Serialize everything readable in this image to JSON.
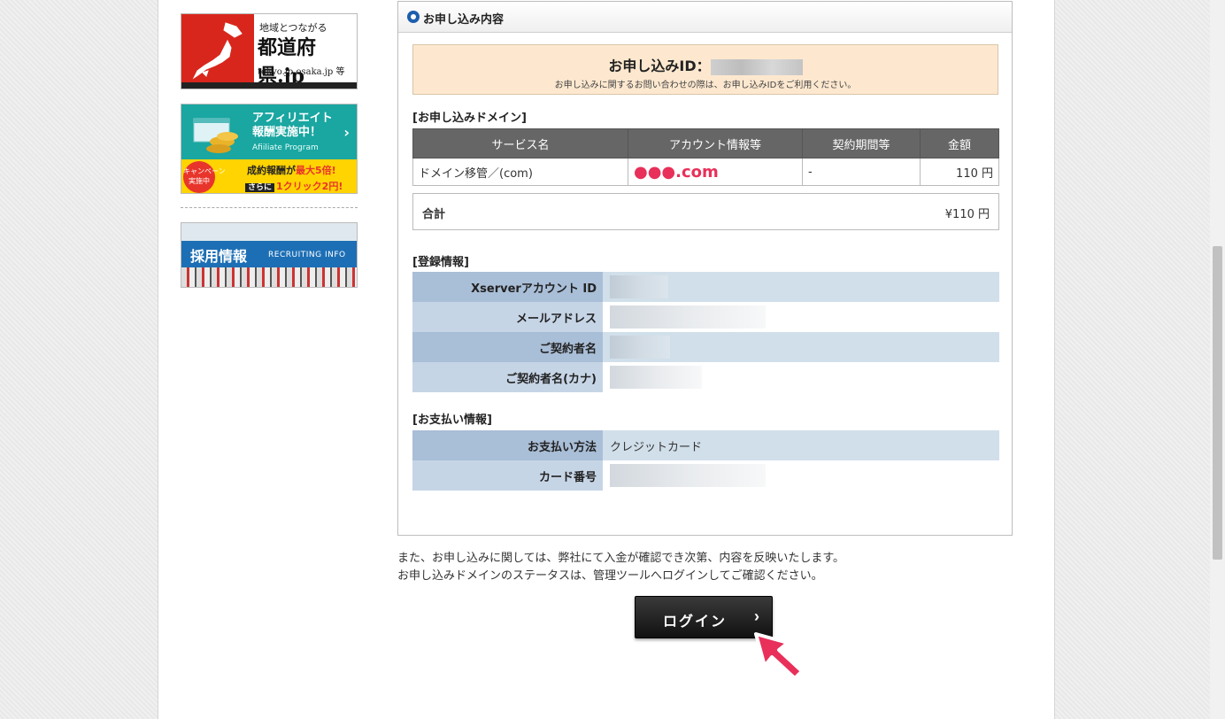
{
  "sidebar": {
    "pref_banner": {
      "line1": "地域とつながる",
      "line2": "都道府県.jp",
      "line3": "tokyo.jp osaka.jp 等"
    },
    "affiliate_banner": {
      "title": "アフィリエイト\n報酬実施中！",
      "subtitle": "Afiiliate Program",
      "campaign": "キャンペーン\n実施中",
      "line1_pre": "成約報酬が",
      "line1_hl": "最大5倍!",
      "line2_tag": "さらに",
      "line2": "1クリック2円!"
    },
    "recruit_banner": {
      "title": "採用情報",
      "subtitle": "RECRUITING INFO"
    }
  },
  "panel": {
    "title": "お申し込み内容",
    "order_id_label": "お申し込みID：",
    "order_id_note": "お申し込みに関するお問い合わせの際は、お申し込みIDをご利用ください。",
    "domain_section": "[お申し込みドメイン]",
    "columns": [
      "サービス名",
      "アカウント情報等",
      "契約期間等",
      "金額"
    ],
    "rows": [
      {
        "service": "ドメイン移管／(com)",
        "account": "●●●.com",
        "period": "-",
        "amount": "110 円"
      }
    ],
    "total_label": "合計",
    "total_value": "¥110 円",
    "registration_section": "[登録情報]",
    "registration": [
      {
        "label": "Xserverアカウント ID"
      },
      {
        "label": "メールアドレス"
      },
      {
        "label": "ご契約者名"
      },
      {
        "label": "ご契約者名(カナ)"
      }
    ],
    "payment_section": "[お支払い情報]",
    "payment": [
      {
        "label": "お支払い方法",
        "value": "クレジットカード"
      },
      {
        "label": "カード番号",
        "value": ""
      }
    ]
  },
  "note": {
    "line1": "また、お申し込みに関しては、弊社にて入金が確認でき次第、内容を反映いたします。",
    "line2": "お申し込みドメインのステータスは、管理ツールへログインしてご確認ください。"
  },
  "login_button": "ログイン",
  "colors": {
    "accent": "#1d5fad",
    "pointer": "#e8305a",
    "header": "#666666"
  }
}
